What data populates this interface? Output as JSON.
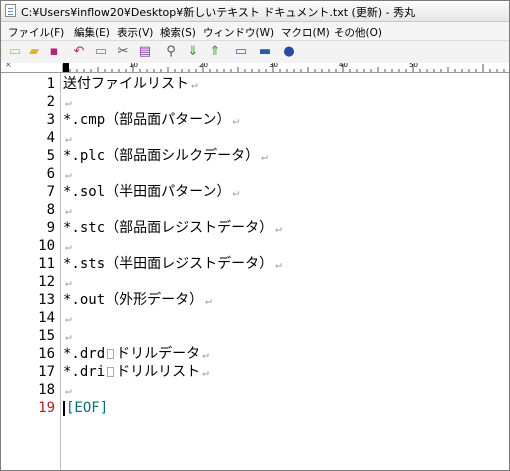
{
  "window": {
    "title": "C:¥Users¥inflow20¥Desktop¥新しいテキスト ドキュメント.txt (更新) - 秀丸"
  },
  "menu": [
    {
      "label": "ファイル(F)",
      "key": "file"
    },
    {
      "label": "編集(E)",
      "key": "edit"
    },
    {
      "label": "表示(V)",
      "key": "view"
    },
    {
      "label": "検索(S)",
      "key": "search"
    },
    {
      "label": "ウィンドウ(W)",
      "key": "window"
    },
    {
      "label": "マクロ(M)",
      "key": "macro"
    },
    {
      "label": "その他(O)",
      "key": "other"
    }
  ],
  "toolbar": [
    {
      "name": "new-file-icon",
      "glyph": "▭",
      "color": "#d8b45a"
    },
    {
      "name": "open-folder-icon",
      "glyph": "▰",
      "color": "#e0b030"
    },
    {
      "name": "save-icon",
      "glyph": "▪",
      "color": "#b0247a"
    },
    {
      "name": "undo-icon",
      "glyph": "↶",
      "color": "#c0207a"
    },
    {
      "name": "copy-icon",
      "glyph": "▭",
      "color": "#7a7a9a"
    },
    {
      "name": "cut-icon",
      "glyph": "✂",
      "color": "#555555"
    },
    {
      "name": "paste-icon",
      "glyph": "▤",
      "color": "#8a3aa0"
    },
    {
      "name": "find-icon",
      "glyph": "⚲",
      "color": "#555555"
    },
    {
      "name": "find-next-icon",
      "glyph": "⇓",
      "color": "#2a9a2a"
    },
    {
      "name": "find-prev-icon",
      "glyph": "⇑",
      "color": "#2a9a2a"
    },
    {
      "name": "grep-icon",
      "glyph": "▭",
      "color": "#3a6ab0"
    },
    {
      "name": "window-icon",
      "glyph": "▬",
      "color": "#2a5aa0"
    },
    {
      "name": "help-icon",
      "glyph": "●",
      "color": "#2a4aa0"
    }
  ],
  "ruler": {
    "labels": [
      "10",
      "20",
      "30",
      "40",
      "50"
    ],
    "x_mark": "×"
  },
  "editor": {
    "lines": [
      {
        "n": "1",
        "text": "送付ファイルリスト"
      },
      {
        "n": "2",
        "text": ""
      },
      {
        "n": "3",
        "text": "*.cmp（部品面パターン）"
      },
      {
        "n": "4",
        "text": ""
      },
      {
        "n": "5",
        "text": "*.plc（部品面シルクデータ）"
      },
      {
        "n": "6",
        "text": ""
      },
      {
        "n": "7",
        "text": "*.sol（半田面パターン）"
      },
      {
        "n": "8",
        "text": ""
      },
      {
        "n": "9",
        "text": "*.stc（部品面レジストデータ）"
      },
      {
        "n": "10",
        "text": ""
      },
      {
        "n": "11",
        "text": "*.sts（半田面レジストデータ）"
      },
      {
        "n": "12",
        "text": ""
      },
      {
        "n": "13",
        "text": "*.out（外形データ）"
      },
      {
        "n": "14",
        "text": ""
      },
      {
        "n": "15",
        "text": ""
      },
      {
        "n": "16",
        "text_a": "*.drd",
        "text_b": "ドリルデータ"
      },
      {
        "n": "17",
        "text_a": "*.dri",
        "text_b": "ドリルリスト"
      },
      {
        "n": "18",
        "text": ""
      },
      {
        "n": "19",
        "text": "[EOF]"
      }
    ],
    "newline_mark": "↵",
    "eof_color": "#0a6b7a"
  }
}
